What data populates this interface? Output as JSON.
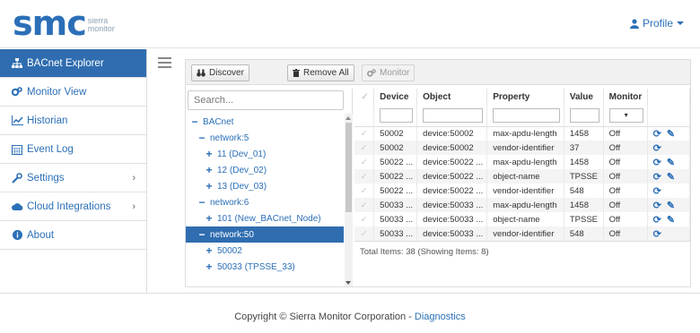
{
  "brand": {
    "logo_text": "smc",
    "logo_sub1": "sierra",
    "logo_sub2": "monitor"
  },
  "header": {
    "profile_label": "Profile"
  },
  "sidebar": {
    "items": [
      {
        "label": "BACnet Explorer",
        "icon": "network-icon"
      },
      {
        "label": "Monitor View",
        "icon": "cogs-icon"
      },
      {
        "label": "Historian",
        "icon": "line-chart-icon"
      },
      {
        "label": "Event Log",
        "icon": "calendar-icon"
      },
      {
        "label": "Settings",
        "icon": "wrench-icon"
      },
      {
        "label": "Cloud Integrations",
        "icon": "cloud-icon"
      },
      {
        "label": "About",
        "icon": "info-icon"
      }
    ]
  },
  "toolbar": {
    "discover": "Discover",
    "remove_all": "Remove All",
    "monitor": "Monitor"
  },
  "tree": {
    "search_placeholder": "Search...",
    "nodes": [
      {
        "label": "BACnet",
        "sym": "−"
      },
      {
        "label": "network:5",
        "sym": "−"
      },
      {
        "label": "11 (Dev_01)",
        "sym": "+"
      },
      {
        "label": "12 (Dev_02)",
        "sym": "+"
      },
      {
        "label": "13 (Dev_03)",
        "sym": "+"
      },
      {
        "label": "network:6",
        "sym": "−"
      },
      {
        "label": "101 (New_BACnet_Node)",
        "sym": "+"
      },
      {
        "label": "network:50",
        "sym": "−"
      },
      {
        "label": "50002",
        "sym": "+"
      },
      {
        "label": "50033 (TPSSE_33)",
        "sym": "+"
      }
    ]
  },
  "grid": {
    "columns": [
      "Device",
      "Object",
      "Property",
      "Value",
      "Monitor"
    ],
    "filter_select": "▾",
    "rows": [
      {
        "device": "50002",
        "object": "device:50002",
        "property": "max-apdu-length",
        "value": "1458",
        "monitor": "Off",
        "edit": true
      },
      {
        "device": "50002",
        "object": "device:50002",
        "property": "vendor-identifier",
        "value": "37",
        "monitor": "Off",
        "edit": false
      },
      {
        "device": "50022 ...",
        "object": "device:50022 ...",
        "property": "max-apdu-length",
        "value": "1458",
        "monitor": "Off",
        "edit": true
      },
      {
        "device": "50022 ...",
        "object": "device:50022 ...",
        "property": "object-name",
        "value": "TPSSE",
        "monitor": "Off",
        "edit": true
      },
      {
        "device": "50022 ...",
        "object": "device:50022 ...",
        "property": "vendor-identifier",
        "value": "548",
        "monitor": "Off",
        "edit": false
      },
      {
        "device": "50033 ...",
        "object": "device:50033 ...",
        "property": "max-apdu-length",
        "value": "1458",
        "monitor": "Off",
        "edit": true
      },
      {
        "device": "50033 ...",
        "object": "device:50033 ...",
        "property": "object-name",
        "value": "TPSSE",
        "monitor": "Off",
        "edit": true
      },
      {
        "device": "50033 ...",
        "object": "device:50033 ...",
        "property": "vendor-identifier",
        "value": "548",
        "monitor": "Off",
        "edit": false
      }
    ],
    "total_text": "Total Items: 38 (Showing Items: 8)"
  },
  "footer": {
    "copyright": "Copyright © Sierra Monitor Corporation -",
    "link": "Diagnostics"
  },
  "colors": {
    "accent": "#2f6db0",
    "link": "#2b6fb7"
  }
}
